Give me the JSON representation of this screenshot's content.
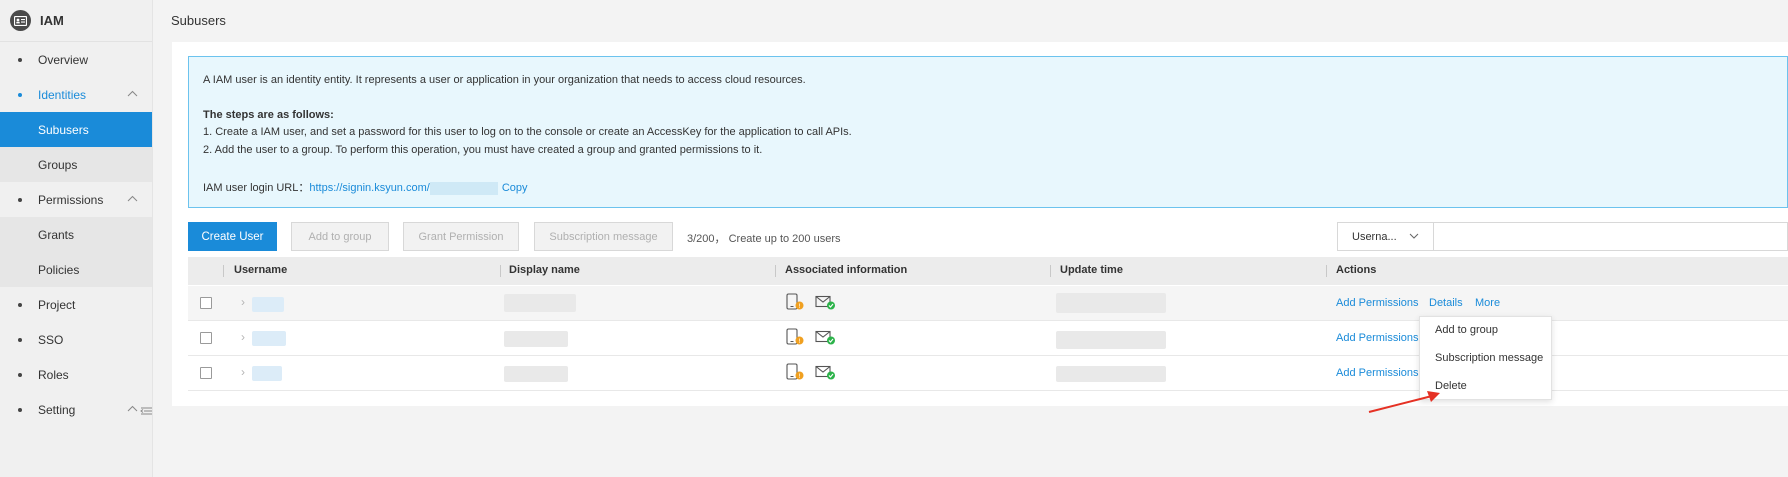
{
  "sidebar": {
    "brand": "IAM",
    "items": [
      {
        "label": "Overview"
      },
      {
        "label": "Identities"
      },
      {
        "label": "Subusers"
      },
      {
        "label": "Groups"
      },
      {
        "label": "Permissions"
      },
      {
        "label": "Grants"
      },
      {
        "label": "Policies"
      },
      {
        "label": "Project"
      },
      {
        "label": "SSO"
      },
      {
        "label": "Roles"
      },
      {
        "label": "Setting"
      }
    ]
  },
  "page": {
    "title": "Subusers"
  },
  "info": {
    "intro": "A IAM user is an identity entity. It represents a user or application in your organization that needs to access cloud resources.",
    "steps_title": "The steps are as follows:",
    "step1": "1. Create a IAM user, and set a password for this user to log on to the console or create an AccessKey for the application to call APIs.",
    "step2": "2. Add the user to a group. To perform this operation, you must have created a group and granted permissions to it.",
    "login_label": "IAM user login URL：",
    "login_url": "https://signin.ksyun.com/",
    "copy": "Copy"
  },
  "toolbar": {
    "create_user": "Create User",
    "add_to_group": "Add to group",
    "grant_permission": "Grant Permission",
    "subscription_message": "Subscription message",
    "quota": "3/200，  Create up to 200 users",
    "filter_select": "Userna...",
    "filter_placeholder": ""
  },
  "table": {
    "headers": [
      "Username",
      "Display name",
      "Associated information",
      "Update time",
      "Actions"
    ],
    "rows": [
      {
        "add_permissions": "Add Permissions",
        "details": "Details",
        "more": "More"
      },
      {
        "add_permissions": "Add Permissions"
      },
      {
        "add_permissions": "Add Permissions"
      }
    ]
  },
  "more_menu": {
    "items": [
      "Add to group",
      "Subscription message",
      "Delete"
    ]
  },
  "colors": {
    "accent": "#1a8bd9",
    "warning": "#f0a020",
    "success": "#2cb34a",
    "annotation": "#e53124"
  }
}
